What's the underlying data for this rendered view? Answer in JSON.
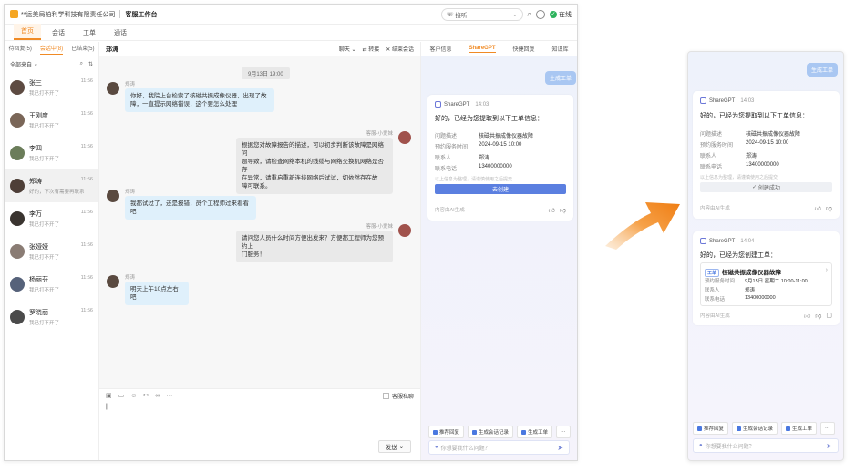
{
  "window": {
    "company": "**运美局柏利学科技有限责任公司",
    "title": "客服工作台",
    "phone_label": "接听",
    "status": "在线"
  },
  "nav_tabs": [
    {
      "label": "首页",
      "active": true
    },
    {
      "label": "会话",
      "active": false
    },
    {
      "label": "工单",
      "active": false
    },
    {
      "label": "通话",
      "active": false
    }
  ],
  "left": {
    "tabs": [
      {
        "label": "待回复(5)",
        "active": false
      },
      {
        "label": "会话中(8)",
        "active": true
      },
      {
        "label": "已结束(5)",
        "active": false
      }
    ],
    "filter": "全部来自",
    "conversations": [
      {
        "name": "张三",
        "msg": "我已打不开了",
        "time": "11:56",
        "selected": false,
        "avatar_color": "#5d4b42"
      },
      {
        "name": "王刚度",
        "msg": "我已打不开了",
        "time": "11:56",
        "selected": false,
        "avatar_color": "#7a6658"
      },
      {
        "name": "李四",
        "msg": "我已打不开了",
        "time": "11:56",
        "selected": false,
        "avatar_color": "#6b7d5a"
      },
      {
        "name": "郑涛",
        "msg": "好的，下次有需要再联系",
        "time": "11:56",
        "selected": true,
        "avatar_color": "#4e3f38"
      },
      {
        "name": "李万",
        "msg": "我已打不开了",
        "time": "11:56",
        "selected": false,
        "avatar_color": "#3a3430"
      },
      {
        "name": "张娅娅",
        "msg": "我已打不开了",
        "time": "11:56",
        "selected": false,
        "avatar_color": "#8a7c74"
      },
      {
        "name": "杨丽芬",
        "msg": "我已打不开了",
        "time": "11:56",
        "selected": false,
        "avatar_color": "#56627a"
      },
      {
        "name": "罗晓丽",
        "msg": "我已打不开了",
        "time": "11:56",
        "selected": false,
        "avatar_color": "#4b4b4b"
      }
    ]
  },
  "chat": {
    "contact_name": "郑涛",
    "actions": [
      "聊天",
      "转接",
      "结束会话"
    ],
    "date": "9月13日 19:00",
    "messages": [
      {
        "side": "in",
        "name": "郑涛",
        "lines": [
          "你好，我院上台检索了核磁共振成像仪器，出现了故",
          "障，一直提示网络错误，这个要怎么处理"
        ]
      },
      {
        "side": "out",
        "name": "客服-小爱妹",
        "lines": [
          "根据您对故障报告的描述，可以初步判断该故障是网络问",
          "题导致，请检查网络本机的线缆与网络交换机网络是否存",
          "在异常，请重启重新连接网络后试试，如依然存在故",
          "障可联系。"
        ]
      },
      {
        "side": "in",
        "name": "郑涛",
        "lines": [
          "我都试过了，还是报错，员个工程师过来看看吧"
        ]
      },
      {
        "side": "out",
        "name": "客服-小爱妹",
        "lines": [
          "请问您人员什么时间方便出发来？方便都工程师为您预约上",
          "门服务！"
        ]
      },
      {
        "side": "in",
        "name": "郑涛",
        "lines": [
          "明天上午10点左右吧"
        ]
      }
    ],
    "toolbar_checkbox": "客服私聊",
    "send_label": "发送"
  },
  "right": {
    "tabs": [
      {
        "label": "客户信息",
        "active": false
      },
      {
        "label": "ShareGPT",
        "active": true
      },
      {
        "label": "快捷回复",
        "active": false
      },
      {
        "label": "知识库",
        "active": false
      }
    ],
    "gen_button": "生成工单",
    "card": {
      "brand": "ShareGPT",
      "time": "14:03",
      "intro": "好的，已经为您提取到以下工单信息：",
      "fields": [
        {
          "k": "问题描述",
          "v": "核磁共振成像仪器故障"
        },
        {
          "k": "预约服务时间",
          "v": "2024-09-15 10:00"
        },
        {
          "k": "联系人",
          "v": "郑涛"
        },
        {
          "k": "联系电话",
          "v": "13400000000"
        }
      ],
      "note": "以上信息为整理，请谨慎使用之后提交",
      "confirm_button": "去创建",
      "footer": "内容由AI生成"
    },
    "quick_buttons": [
      "推荐回复",
      "生成会话记录",
      "生成工单"
    ],
    "input_placeholder": "你想要我什么问题？"
  },
  "zoom": {
    "gen_button": "生成工单",
    "card1": {
      "brand": "ShareGPT",
      "time": "14:03",
      "intro": "好的，已经为您提取到以下工单信息：",
      "fields": [
        {
          "k": "问题描述",
          "v": "核磁共振成像仪器故障"
        },
        {
          "k": "预约服务时间",
          "v": "2024-09-15 10:00"
        },
        {
          "k": "联系人",
          "v": "郑涛"
        },
        {
          "k": "联系电话",
          "v": "13400000000"
        }
      ],
      "note": "以上信息为整理，请谨慎使用之后提交",
      "status_button": "创建成功",
      "footer": "内容由AI生成"
    },
    "card2": {
      "brand": "ShareGPT",
      "time": "14:04",
      "intro": "好的，已经为您创建工单：",
      "tag": "工单",
      "order_title": "核磁共振成像仪器故障",
      "fields": [
        {
          "k": "预约服务时间",
          "v": "9月15日 星期二 10:00-11:00"
        },
        {
          "k": "联系人",
          "v": "郑涛"
        },
        {
          "k": "联系电话",
          "v": "13400000000"
        }
      ],
      "footer": "内容由AI生成"
    },
    "quick_buttons": [
      "推荐回复",
      "生成会话记录",
      "生成工单"
    ],
    "input_placeholder": "你想要我什么问题？"
  },
  "colors": {
    "accent": "#f08a24",
    "bubble_in": "#dff0fb",
    "primary_blue": "#4a78e0",
    "online": "#2db35d"
  }
}
